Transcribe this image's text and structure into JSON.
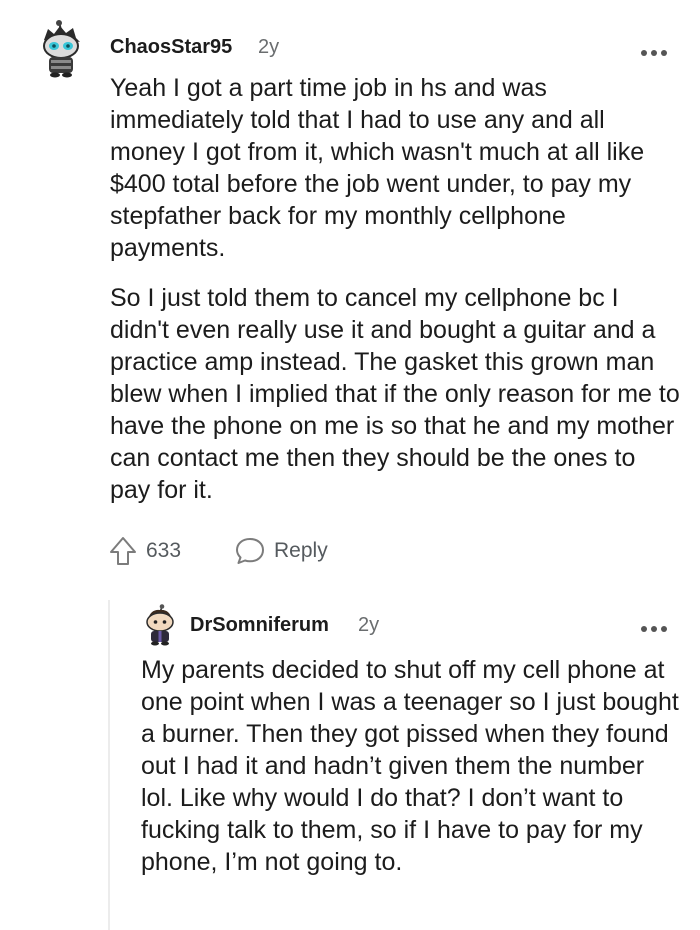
{
  "comment": {
    "author": "ChaosStar95",
    "age": "2y",
    "paragraphs": [
      "Yeah I got a part time job in hs and was immediately told that I had to use any and all money I got from it, which wasn't much at all like $400 total before the job went under, to pay my stepfather back for my monthly cellphone payments.",
      "So I just told them to cancel my cellphone bc I didn't even really use it and bought a guitar and a practice amp instead. The gasket this grown man blew when I implied that if the only reason for me to have the phone on me is so that he and my mother can contact me then they should be the ones to pay for it."
    ],
    "upvotes": "633",
    "reply_label": "Reply",
    "icons": {
      "avatar": "snoo-avatar-icon",
      "more": "more-options-icon",
      "upvote": "upvote-arrow-icon",
      "reply": "comment-bubble-icon"
    }
  },
  "reply": {
    "author": "DrSomniferum",
    "age": "2y",
    "text": "My parents decided to shut off my cell phone at one point when I was a teenager so I just bought a burner. Then they got pissed when they found out I had it and hadn’t given them the number lol. Like why would I do that? I don’t want to fucking talk to them, so if I have to pay for my phone, I’m not going to.",
    "icons": {
      "avatar": "snoo-avatar-icon",
      "more": "more-options-icon"
    }
  }
}
